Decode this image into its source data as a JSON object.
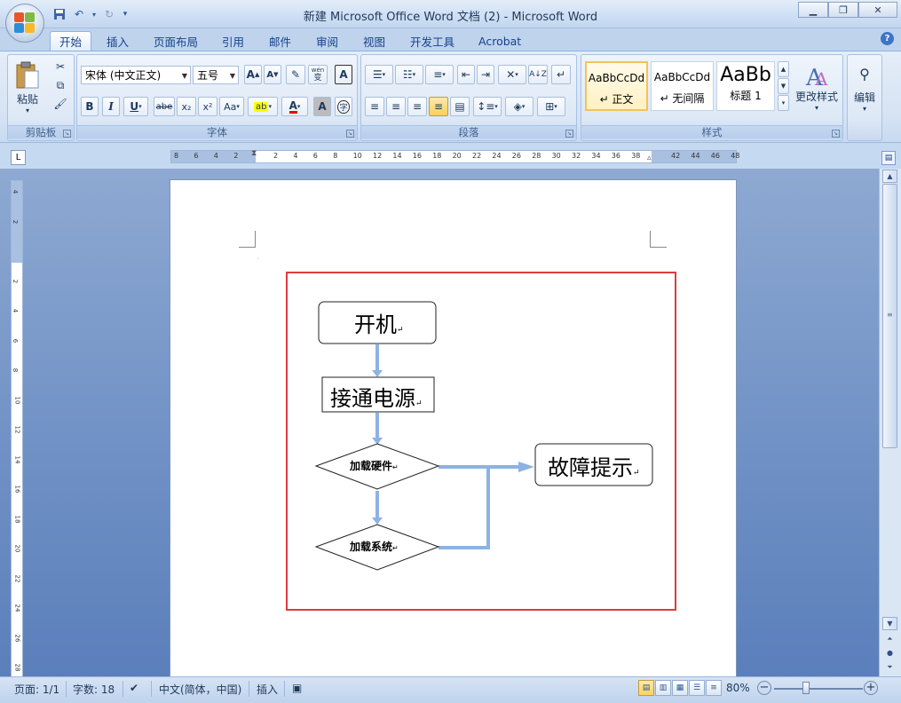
{
  "window": {
    "title": "新建 Microsoft Office Word 文档 (2) - Microsoft Word"
  },
  "tabs": [
    "开始",
    "插入",
    "页面布局",
    "引用",
    "邮件",
    "审阅",
    "视图",
    "开发工具",
    "Acrobat"
  ],
  "ribbon": {
    "clipboard": {
      "paste_label": "粘贴",
      "group_label": "剪贴板"
    },
    "font": {
      "font_name": "宋体 (中文正文)",
      "font_size": "五号",
      "group_label": "字体",
      "bold": "B",
      "italic": "I",
      "underline": "U",
      "strike": "abe",
      "subscript": "x₂",
      "superscript": "x²",
      "change_case": "Aa",
      "grow": "A",
      "shrink": "A",
      "char_border": "A",
      "char_shading": "A",
      "enclose": "字",
      "phonetic": "wén"
    },
    "paragraph": {
      "group_label": "段落"
    },
    "styles": {
      "group_label": "样式",
      "items": [
        {
          "sample": "AaBbCcDd",
          "name": "↵ 正文"
        },
        {
          "sample": "AaBbCcDd",
          "name": "↵ 无间隔"
        },
        {
          "sample": "AaBb",
          "name": "标题 1"
        }
      ],
      "change_styles_label": "更改样式"
    },
    "editing": {
      "label": "编辑"
    }
  },
  "ruler": {
    "numbers": [
      "8",
      "6",
      "4",
      "2",
      "2",
      "4",
      "6",
      "8",
      "10",
      "12",
      "14",
      "16",
      "18",
      "20",
      "22",
      "24",
      "26",
      "28",
      "30",
      "32",
      "34",
      "36",
      "38",
      "42",
      "44",
      "46",
      "48"
    ],
    "vnumbers": [
      "4",
      "2",
      "2",
      "4",
      "6",
      "8",
      "10",
      "12",
      "14",
      "16",
      "18",
      "20",
      "22",
      "24",
      "26",
      "28"
    ]
  },
  "flowchart": {
    "start": "开机",
    "power": "接通电源",
    "load_hardware": "加载硬件",
    "load_system": "加载系统",
    "fault": "故障提示",
    "paragraph_mark": "↵"
  },
  "statusbar": {
    "page": "页面: 1/1",
    "words": "字数: 18",
    "language": "中文(简体，中国)",
    "mode": "插入",
    "zoom": "80%"
  },
  "colors": {
    "accent": "#15428b",
    "selection_border": "#e03a3e",
    "connector": "#8db3e2"
  }
}
